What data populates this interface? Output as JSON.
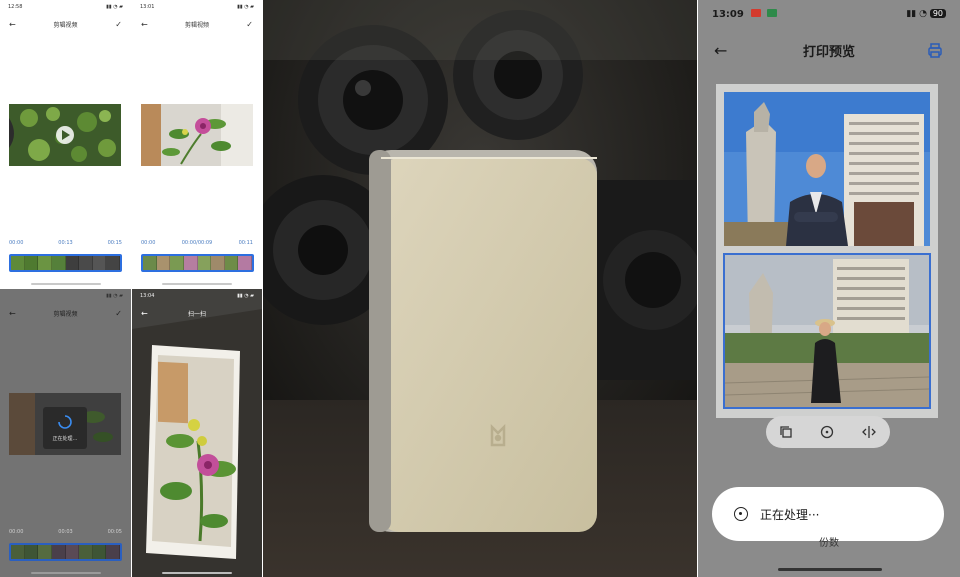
{
  "screens": {
    "clip_video": {
      "status_time": "12:58",
      "title": "剪辑视频",
      "time_start": "00:00",
      "time_mid": "00:13",
      "time_end": "00:15"
    },
    "clip_video_2": {
      "status_time": "13:01",
      "title": "剪辑视频",
      "time_start": "00:00",
      "time_mid": "00:00/00:09",
      "time_end": "00:11"
    },
    "processing": {
      "title": "剪辑视频",
      "overlay_text": "正在处理…",
      "time_start": "00:00",
      "time_mid": "00:03",
      "time_end": "00:05"
    },
    "scan": {
      "status_time": "13:04",
      "title": "扫一扫"
    },
    "print_preview": {
      "status_time": "13:09",
      "battery": "90",
      "title": "打印预览",
      "toast_text": "正在处理···",
      "below_text": "份数"
    }
  },
  "colors": {
    "accent_blue": "#2d6fe0",
    "timeline_blue": "#4a7cc0",
    "printer_body": "#d8cfb2",
    "preview_bg": "#8b8b8b"
  },
  "icons": [
    "back-arrow-icon",
    "checkmark-icon",
    "play-icon",
    "loading-spinner-icon",
    "printer-icon",
    "copy-icon",
    "rotate-icon",
    "flip-icon",
    "mi-logo-icon"
  ]
}
